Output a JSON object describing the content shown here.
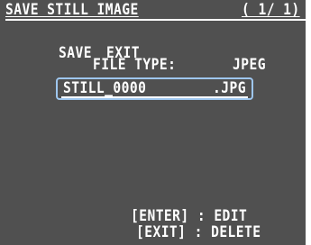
{
  "header": {
    "title": "SAVE STILL IMAGE",
    "page_indicator": "( 1/ 1)"
  },
  "menu": {
    "save_label": "SAVE",
    "exit_label": "EXIT"
  },
  "file_type": {
    "label": "FILE TYPE:",
    "value": "JPEG"
  },
  "filename": {
    "name": "STILL_0000",
    "extension": ".JPG"
  },
  "hints": {
    "enter": "[ENTER] : EDIT",
    "exit": "[EXIT] : DELETE"
  },
  "colors": {
    "background": "#505050",
    "text": "#ffffff",
    "selection_border": "#9ec6ee"
  }
}
